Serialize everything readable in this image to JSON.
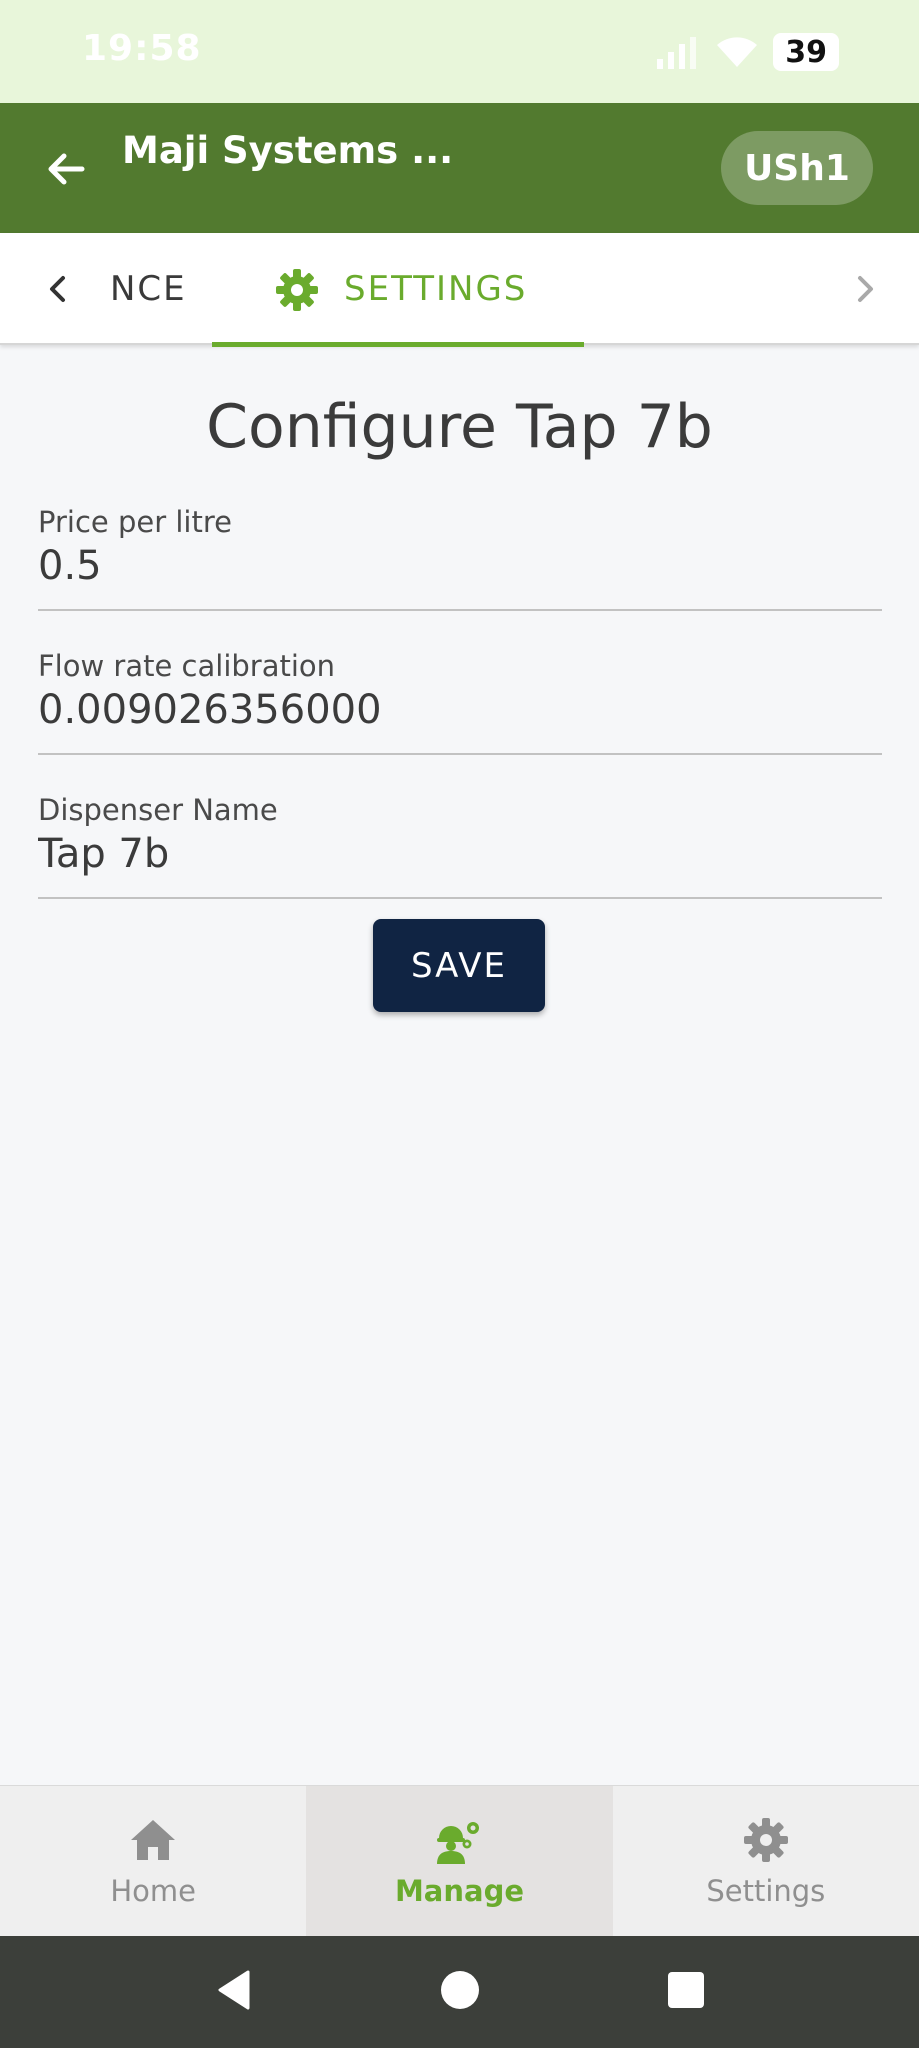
{
  "status_bar": {
    "time": "19:58",
    "battery": "39"
  },
  "app_bar": {
    "title": "Maji Systems ...",
    "currency": "USh1"
  },
  "tabs": {
    "partial_label": "NCE",
    "active_label": "SETTINGS"
  },
  "main": {
    "title": "Configure Tap 7b",
    "fields": [
      {
        "label": "Price per litre",
        "value": "0.5"
      },
      {
        "label": "Flow rate calibration",
        "value": "0.009026356000"
      },
      {
        "label": "Dispenser Name",
        "value": "Tap 7b"
      }
    ],
    "save_label": "SAVE"
  },
  "bottom_nav": {
    "items": [
      {
        "label": "Home",
        "icon": "home-icon"
      },
      {
        "label": "Manage",
        "icon": "manage-icon"
      },
      {
        "label": "Settings",
        "icon": "gear-icon"
      }
    ],
    "active": "Manage"
  },
  "colors": {
    "app_bar": "#527a2f",
    "accent": "#6aab2d",
    "button": "#102443",
    "status_bar": "#e8f6da"
  }
}
